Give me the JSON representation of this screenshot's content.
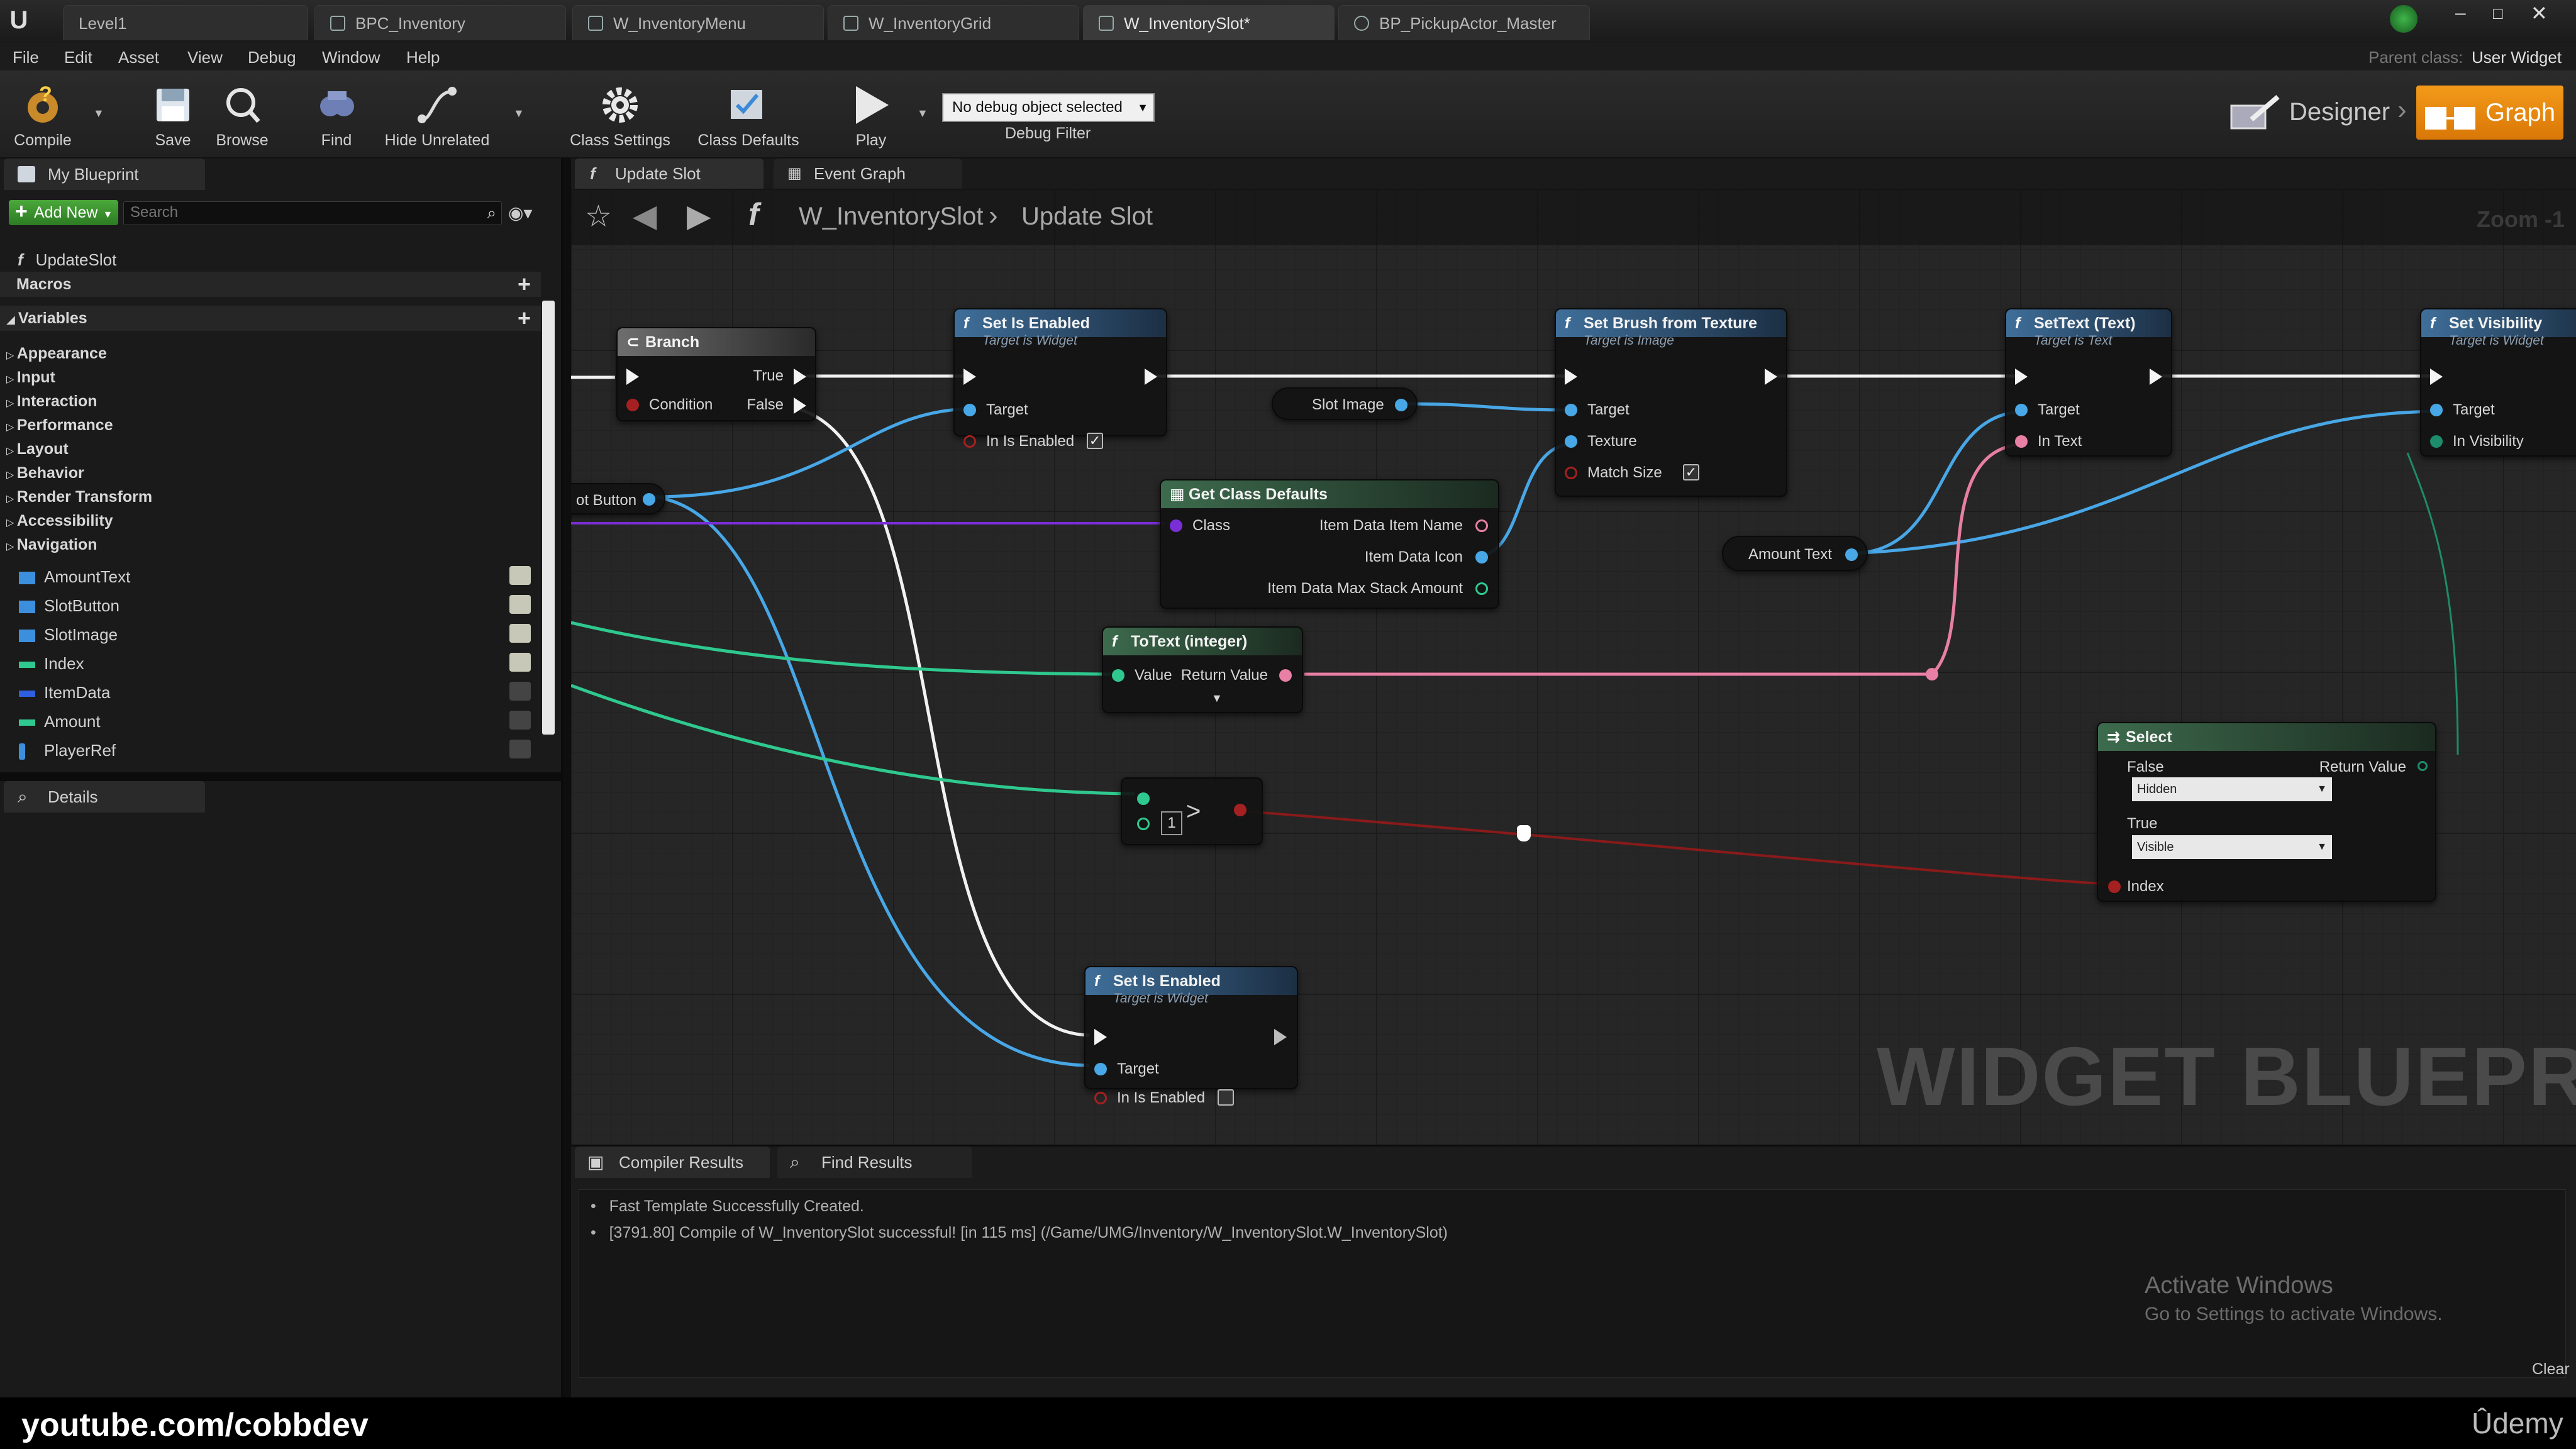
{
  "doc_tabs": [
    {
      "label": "Level1"
    },
    {
      "label": "BPC_Inventory"
    },
    {
      "label": "W_InventoryMenu"
    },
    {
      "label": "W_InventoryGrid"
    },
    {
      "label": "W_InventorySlot*"
    },
    {
      "label": "BP_PickupActor_Master"
    }
  ],
  "titlebar": {
    "parent_class_label": "Parent class:",
    "parent_class_value": "User Widget"
  },
  "menu": [
    "File",
    "Edit",
    "Asset",
    "View",
    "Debug",
    "Window",
    "Help"
  ],
  "toolbar": {
    "compile": "Compile",
    "save": "Save",
    "browse": "Browse",
    "find": "Find",
    "hide_unrelated": "Hide Unrelated",
    "class_settings": "Class Settings",
    "class_defaults": "Class Defaults",
    "play": "Play",
    "debug_select": "No debug object selected",
    "debug_filter": "Debug Filter",
    "designer": "Designer",
    "graph": "Graph"
  },
  "left_panel": {
    "tab": "My Blueprint",
    "add_new": "Add New",
    "search_placeholder": "Search",
    "function": "UpdateSlot",
    "macros": "Macros",
    "variables": "Variables",
    "categories": [
      "Appearance",
      "Input",
      "Interaction",
      "Performance",
      "Layout",
      "Behavior",
      "Render Transform",
      "Accessibility",
      "Navigation"
    ],
    "vars": [
      {
        "name": "AmountText",
        "color": "#3c8fdc"
      },
      {
        "name": "SlotButton",
        "color": "#3c8fdc"
      },
      {
        "name": "SlotImage",
        "color": "#3c8fdc"
      },
      {
        "name": "Index",
        "color": "#2fc98f"
      },
      {
        "name": "ItemData",
        "color": "#2f5fe0"
      },
      {
        "name": "Amount",
        "color": "#2fc98f"
      },
      {
        "name": "PlayerRef",
        "color": "#3c8fdc"
      }
    ],
    "details_tab": "Details"
  },
  "graph_tabs": {
    "update_slot": "Update Slot",
    "event_graph": "Event Graph"
  },
  "breadcrumb": {
    "root": "W_InventorySlot",
    "leaf": "Update Slot",
    "zoom": "Zoom -1"
  },
  "nodes": {
    "branch": {
      "title": "Branch",
      "true": "True",
      "false": "False",
      "condition": "Condition"
    },
    "set_enabled_1": {
      "title": "Set Is Enabled",
      "sub": "Target is Widget",
      "target": "Target",
      "in_enabled": "In Is Enabled"
    },
    "slot_image": "Slot Image",
    "slot_button": "ot Button",
    "set_brush": {
      "title": "Set Brush from Texture",
      "sub": "Target is Image",
      "target": "Target",
      "texture": "Texture",
      "match": "Match Size"
    },
    "set_text": {
      "title": "SetText (Text)",
      "sub": "Target is Text",
      "target": "Target",
      "in_text": "In Text"
    },
    "set_vis": {
      "title": "Set Visibility",
      "sub": "Target is Widget",
      "target": "Target",
      "in_vis": "In Visibility"
    },
    "class_defaults": {
      "title": "Get Class Defaults",
      "class": "Class",
      "name": "Item Data Item Name",
      "icon": "Item Data Icon",
      "max": "Item Data Max Stack Amount"
    },
    "amount_text": "Amount Text",
    "to_text": {
      "title": "ToText (integer)",
      "value": "Value",
      "ret": "Return Value"
    },
    "compare_value": "1",
    "select": {
      "title": "Select",
      "false": "False",
      "ret": "Return Value",
      "false_opt": "Hidden",
      "true": "True",
      "true_opt": "Visible",
      "index": "Index"
    },
    "set_enabled_2": {
      "title": "Set Is Enabled",
      "sub": "Target is Widget",
      "target": "Target",
      "in_enabled": "In Is Enabled"
    }
  },
  "watermark": "WIDGET BLUEPRINT",
  "bottom": {
    "compiler_tab": "Compiler Results",
    "find_tab": "Find Results",
    "lines": [
      "Fast Template Successfully Created.",
      "[3791.80] Compile of W_InventorySlot successful! [in 115 ms] (/Game/UMG/Inventory/W_InventorySlot.W_InventorySlot)"
    ],
    "activate_title": "Activate Windows",
    "activate_sub": "Go to Settings to activate Windows.",
    "clear": "Clear"
  },
  "youtube": "youtube.com/cobbdev",
  "udemy": "Ûdemy"
}
